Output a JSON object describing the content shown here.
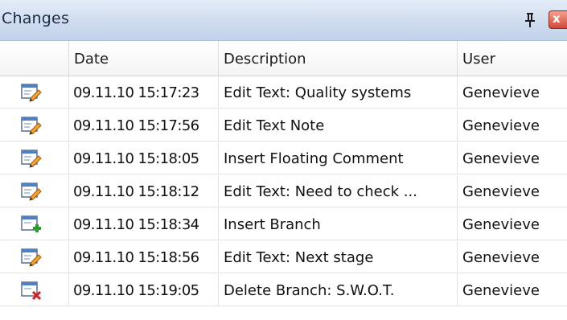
{
  "panel": {
    "title": "Changes",
    "close_label": "x"
  },
  "columns": {
    "icon": "",
    "date": "Date",
    "description": "Description",
    "user": "User"
  },
  "rows": [
    {
      "icon": "edit-text-icon",
      "date": "09.11.10 15:17:23",
      "description": "Edit Text:  Quality systems",
      "user": "Genevieve"
    },
    {
      "icon": "edit-text-icon",
      "date": "09.11.10 15:17:56",
      "description": "Edit Text Note",
      "user": "Genevieve"
    },
    {
      "icon": "edit-text-icon",
      "date": "09.11.10 15:18:05",
      "description": "Insert Floating Comment",
      "user": "Genevieve"
    },
    {
      "icon": "edit-text-icon",
      "date": "09.11.10 15:18:12",
      "description": "Edit Text:  Need to check ...",
      "user": "Genevieve"
    },
    {
      "icon": "insert-branch-icon",
      "date": "09.11.10 15:18:34",
      "description": "Insert Branch",
      "user": "Genevieve"
    },
    {
      "icon": "edit-text-icon",
      "date": "09.11.10 15:18:56",
      "description": "Edit Text:  Next stage",
      "user": "Genevieve"
    },
    {
      "icon": "delete-branch-icon",
      "date": "09.11.10 15:19:05",
      "description": "Delete Branch: S.W.O.T.",
      "user": "Genevieve"
    }
  ],
  "colors": {
    "titlebar": "#cfdcef",
    "close_button": "#d2483a",
    "grid_line": "#e2e2e2"
  }
}
